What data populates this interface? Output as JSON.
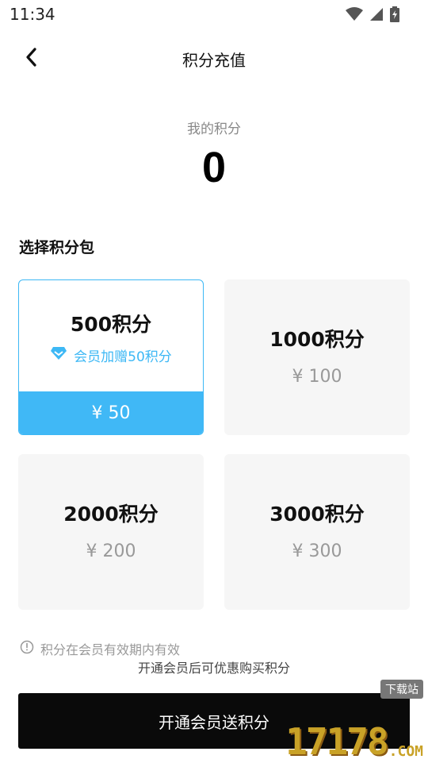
{
  "status_bar": {
    "time": "11:34",
    "icons": [
      "wifi-icon",
      "cell-signal-icon",
      "battery-icon"
    ]
  },
  "nav": {
    "title": "积分充值",
    "back_icon": "chevron-left-icon"
  },
  "points": {
    "label": "我的积分",
    "value": "0"
  },
  "section_title": "选择积分包",
  "packages": [
    {
      "amount": "500积分",
      "bonus": "会员加赠50积分",
      "price": "¥ 50",
      "selected": true
    },
    {
      "amount": "1000积分",
      "price": "¥ 100",
      "selected": false
    },
    {
      "amount": "2000积分",
      "price": "¥ 200",
      "selected": false
    },
    {
      "amount": "3000积分",
      "price": "¥ 300",
      "selected": false
    }
  ],
  "notices": [
    "积分在会员有效期内有效",
    "开通会员后可优惠购买积分"
  ],
  "cta_label": "开通会员送积分",
  "watermark": {
    "main": "17178",
    "suffix": ".COM",
    "badge": "下载站"
  },
  "colors": {
    "accent": "#40b8f6",
    "cta_bg": "#0a0a0a",
    "card_bg": "#f6f6f6"
  }
}
